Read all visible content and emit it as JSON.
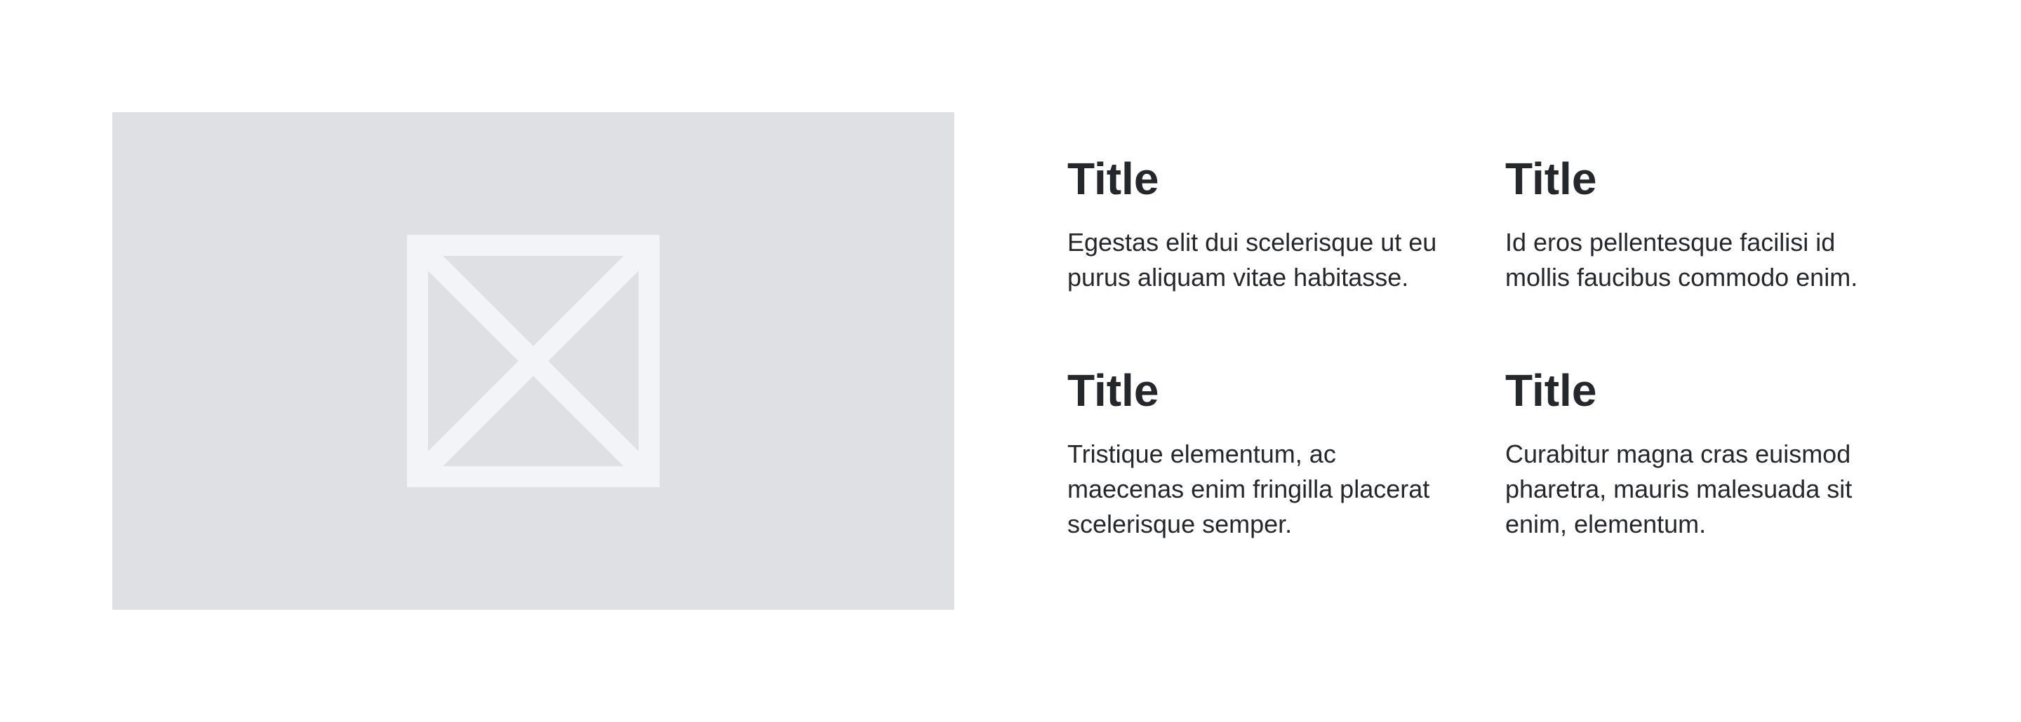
{
  "media": {
    "icon": "image-placeholder-icon",
    "colors": {
      "background": "#dee0e4",
      "icon": "#f3f4f7"
    }
  },
  "features": [
    {
      "title": "Title",
      "text": "Egestas elit dui scelerisque ut eu purus aliquam vitae habitasse."
    },
    {
      "title": "Title",
      "text": "Id eros pellentesque facilisi id mollis faucibus commodo enim."
    },
    {
      "title": "Title",
      "text": "Tristique elementum, ac maecenas enim fringilla placerat scelerisque semper."
    },
    {
      "title": "Title",
      "text": "Curabitur magna cras euismod pharetra, mauris malesuada sit enim, elementum."
    }
  ],
  "colors": {
    "text": "#24272b",
    "page_background": "#ffffff"
  }
}
